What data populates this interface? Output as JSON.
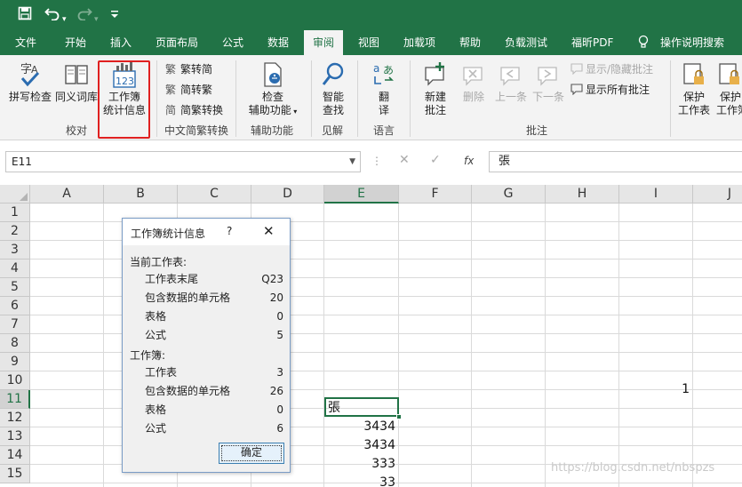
{
  "quick_access": {
    "save_icon": "save-icon",
    "undo_icon": "undo-icon",
    "redo_icon": "redo-icon",
    "customize_icon": "customize-qat-icon"
  },
  "tabs": [
    {
      "label": "文件"
    },
    {
      "label": "开始"
    },
    {
      "label": "插入"
    },
    {
      "label": "页面布局"
    },
    {
      "label": "公式"
    },
    {
      "label": "数据"
    },
    {
      "label": "审阅"
    },
    {
      "label": "视图"
    },
    {
      "label": "加载项"
    },
    {
      "label": "帮助"
    },
    {
      "label": "负载测试"
    },
    {
      "label": "福昕PDF"
    },
    {
      "label": "操作说明搜索"
    }
  ],
  "ribbon": {
    "proofing": {
      "spell_check": "拼写检查",
      "thesaurus": "同义词库",
      "workbook_stats_line1": "工作簿",
      "workbook_stats_line2": "统计信息",
      "group_label": "校对"
    },
    "chinese_conversion": {
      "trad_to_simp": "繁转简",
      "simp_to_trad": "简转繁",
      "conversion": "简繁转换",
      "group_label": "中文简繁转换"
    },
    "accessibility": {
      "check_line1": "检查",
      "check_line2": "辅助功能",
      "group_label": "辅助功能"
    },
    "insights": {
      "smart_lookup_line1": "智能",
      "smart_lookup_line2": "查找",
      "group_label": "见解"
    },
    "language": {
      "translate_line1": "翻",
      "translate_line2": "译",
      "group_label": "语言"
    },
    "comments": {
      "new_line1": "新建",
      "new_line2": "批注",
      "delete": "删除",
      "previous": "上一条",
      "next": "下一条",
      "show_hide": "显示/隐藏批注",
      "show_all": "显示所有批注",
      "group_label": "批注"
    },
    "protect": {
      "sheet_line1": "保护",
      "sheet_line2": "工作表",
      "workbook_line1": "保护",
      "workbook_line2": "工作簿"
    }
  },
  "formula_bar": {
    "name_box": "E11",
    "fx": "fx",
    "content": "張"
  },
  "columns": [
    "A",
    "B",
    "C",
    "D",
    "E",
    "F",
    "G",
    "H",
    "I",
    "J"
  ],
  "rows": [
    "1",
    "2",
    "3",
    "4",
    "5",
    "6",
    "7",
    "8",
    "9",
    "10",
    "11",
    "12",
    "13",
    "14",
    "15"
  ],
  "cells": {
    "I10": "1",
    "E11": "張",
    "E12": "3434",
    "E13": "3434",
    "E14": "333",
    "E15": "33"
  },
  "dialog": {
    "title": "工作簿统计信息",
    "help": "?",
    "close": "✕",
    "current_sheet_heading": "当前工作表:",
    "sheet_stats": [
      {
        "label": "工作表末尾",
        "value": "Q23"
      },
      {
        "label": "包含数据的单元格",
        "value": "20"
      },
      {
        "label": "表格",
        "value": "0"
      },
      {
        "label": "公式",
        "value": "5"
      }
    ],
    "workbook_heading": "工作簿:",
    "workbook_stats": [
      {
        "label": "工作表",
        "value": "3"
      },
      {
        "label": "包含数据的单元格",
        "value": "26"
      },
      {
        "label": "表格",
        "value": "0"
      },
      {
        "label": "公式",
        "value": "6"
      }
    ],
    "ok": "确定"
  },
  "watermark": "https://blog.csdn.net/nbspzs",
  "colors": {
    "excel_green": "#217346",
    "highlight_red": "#e02020"
  }
}
